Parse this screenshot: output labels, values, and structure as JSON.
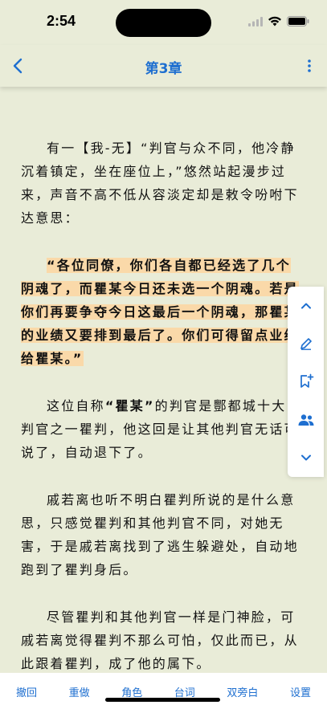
{
  "status": {
    "time": "2:54"
  },
  "nav": {
    "title": "第3章"
  },
  "paragraphs": {
    "p1": "有一【我-无】“判官与众不同，他冷静沉着镇定，坐在座位上，”悠然站起漫步过来，声音不高不低从容淡定却是敕令吩咐下达意思：",
    "p2": "“各位同僚，你们各自都已经选了几个阴魂了，而瞿某今日还未选一个阴魂。若是你们再要争夺今日这最后一个阴魂，那瞿某的业绩又要排到最后了。你们可得留点业绩给瞿某。”",
    "p3a": "这位自称",
    "p3b": "“瞿某”",
    "p3c": "的判官是酆都城十大判官之一瞿判，他这回是让其他判官无话可说了，自动退下了。",
    "p4": "戚若离也听不明白瞿判所说的是什么意思，只感觉瞿判和其他判官不同，对她无害，于是戚若离找到了逃生躲避处，自动地跑到了瞿判身后。",
    "p5": "尽管瞿判和其他判官一样是门神脸，可戚若离觉得瞿判不那么可怕，仅此而已，从此跟着瞿判，成了他的属下。"
  },
  "toolbar": {
    "undo": "撤回",
    "redo": "重做",
    "role": "角色",
    "dialogue": "台词",
    "double_aside": "双旁白",
    "settings": "设置"
  },
  "side_icons": [
    "chevron-up-icon",
    "pencil-icon",
    "bookmark-plus-icon",
    "people-icon",
    "chevron-down-icon"
  ],
  "colors": {
    "accent": "#1e6fd0",
    "highlight": "#fad9a9",
    "background": "#e9ecd8"
  }
}
